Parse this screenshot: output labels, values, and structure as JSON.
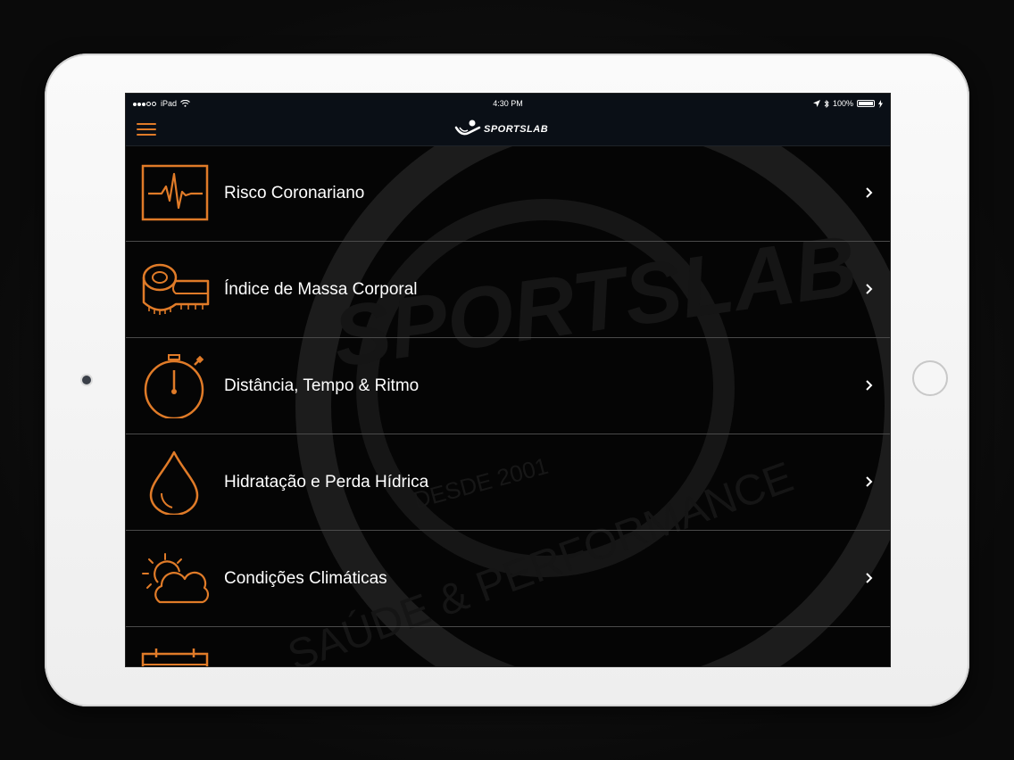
{
  "status_bar": {
    "carrier": "iPad",
    "time": "4:30 PM",
    "battery": "100%"
  },
  "nav": {
    "logo_text": "SPORTSLAB"
  },
  "menu_items": [
    {
      "label": "Risco Coronariano",
      "icon": "heartbeat-monitor-icon"
    },
    {
      "label": "Índice de Massa Corporal",
      "icon": "measuring-tape-icon"
    },
    {
      "label": "Distância, Tempo & Ritmo",
      "icon": "stopwatch-icon"
    },
    {
      "label": "Hidratação e Perda Hídrica",
      "icon": "water-drop-icon"
    },
    {
      "label": "Condições Climáticas",
      "icon": "sun-cloud-icon"
    }
  ],
  "partial_item": {
    "icon": "calendar-icon"
  },
  "watermark": {
    "brand": "SPORTSLAB",
    "tagline": "SAÚDE & PERFORMANCE",
    "since": "DESDE 2001"
  },
  "colors": {
    "accent": "#e07b28",
    "background": "#050505",
    "text": "#ffffff",
    "divider": "#4a4a4a"
  }
}
